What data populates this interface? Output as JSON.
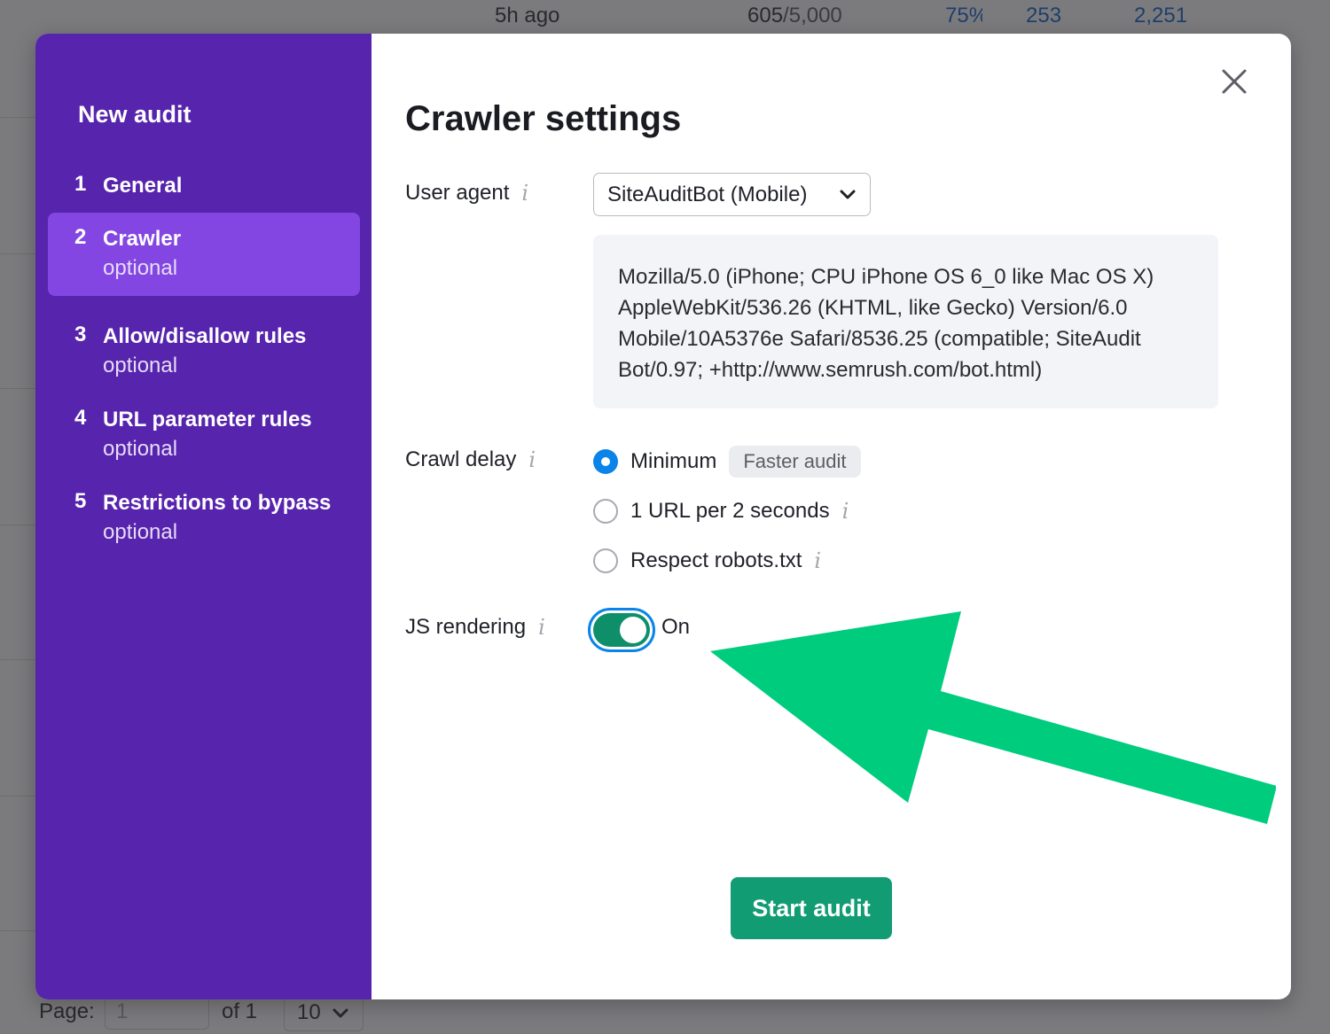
{
  "background": {
    "row": {
      "time": "5h ago",
      "pages_crawled": "605",
      "pages_limit": "/5,000",
      "percent": "75%",
      "errors": "253",
      "warnings": "2,251"
    },
    "pagination": {
      "page_label": "Page:",
      "page_value": "1",
      "of_label": "of 1",
      "per_page": "10"
    }
  },
  "sidebar": {
    "title": "New audit",
    "steps": [
      {
        "number": "1",
        "label": "General",
        "sub": ""
      },
      {
        "number": "2",
        "label": "Crawler",
        "sub": "optional"
      },
      {
        "number": "3",
        "label": "Allow/disallow rules",
        "sub": "optional"
      },
      {
        "number": "4",
        "label": "URL parameter rules",
        "sub": "optional"
      },
      {
        "number": "5",
        "label": "Restrictions to bypass",
        "sub": "optional"
      }
    ],
    "active_step": 2
  },
  "main": {
    "heading": "Crawler settings",
    "user_agent": {
      "label": "User agent",
      "selected": "SiteAuditBot (Mobile)",
      "string": "Mozilla/5.0 (iPhone; CPU iPhone OS 6_0 like Mac OS X) AppleWebKit/536.26 (KHTML, like Gecko) Version/6.0 Mobile/10A5376e Safari/8536.25 (compatible; SiteAudit Bot/0.97; +http://www.semrush.com/bot.html)"
    },
    "crawl_delay": {
      "label": "Crawl delay",
      "options": [
        {
          "label": "Minimum",
          "badge": "Faster audit",
          "checked": true
        },
        {
          "label": "1 URL per 2 seconds",
          "checked": false
        },
        {
          "label": "Respect robots.txt",
          "checked": false
        }
      ]
    },
    "js_rendering": {
      "label": "JS rendering",
      "state": "On",
      "enabled": true
    },
    "start_button": "Start audit",
    "info_glyph": "i"
  },
  "icons": {
    "close": "close-icon",
    "chevron": "chevron-down-icon",
    "info": "info-icon",
    "arrow": "arrow-annotation"
  },
  "colors": {
    "sidebar_bg": "#5724ad",
    "sidebar_active": "#8346e2",
    "primary_button": "#119c74",
    "toggle_on": "#0e8f6a",
    "radio_checked": "#0a84e8",
    "annotation_arrow": "#00cc7e"
  }
}
